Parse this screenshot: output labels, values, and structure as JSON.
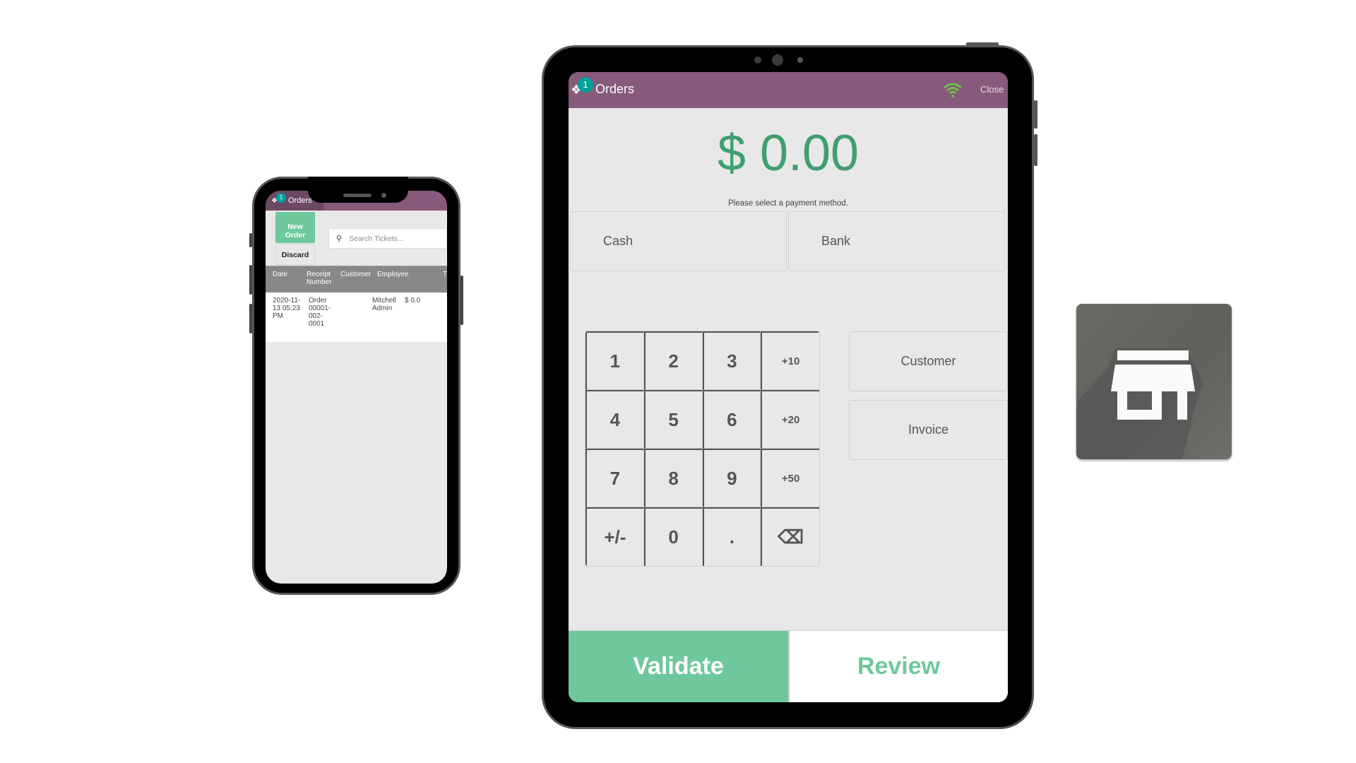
{
  "phone": {
    "header": {
      "title": "Orders",
      "badge_count": "1",
      "logo_icon": "ticket-icon"
    },
    "new_order_label": "New\nOrder",
    "discard_label": "Discard",
    "search": {
      "placeholder": "Search Tickets...",
      "value": "",
      "icon": "search-icon"
    },
    "table": {
      "columns": [
        "Date",
        "Receipt\nNumber",
        "Customer",
        "Employee",
        "T"
      ],
      "rows": [
        {
          "date": "2020-11-\n13 05:23\nPM",
          "receipt": "Order\n00001-\n002-\n0001",
          "customer": "",
          "employee": "Mitchell\nAdmin",
          "total": "$ 0.0"
        }
      ]
    }
  },
  "tablet": {
    "header": {
      "title": "Orders",
      "badge_count": "1",
      "logo_icon": "ticket-icon",
      "wifi_icon": "wifi-icon",
      "close_label": "Close"
    },
    "amount": "$ 0.00",
    "hint": "Please select a payment method.",
    "payment_methods": [
      "Cash",
      "Bank"
    ],
    "numpad": [
      "1",
      "2",
      "3",
      "+10",
      "4",
      "5",
      "6",
      "+20",
      "7",
      "8",
      "9",
      "+50",
      "+/-",
      "0",
      ".",
      "⌫"
    ],
    "customer_label": "Customer",
    "invoice_label": "Invoice",
    "validate_label": "Validate",
    "review_label": "Review"
  },
  "app_icon": {
    "name": "store-icon"
  },
  "colors": {
    "header_purple": "#875a7b",
    "accent_green": "#6ec89b",
    "amount_green": "#3e9f6f",
    "badge_teal": "#00a09d",
    "wifi_green": "#6cc04a"
  }
}
